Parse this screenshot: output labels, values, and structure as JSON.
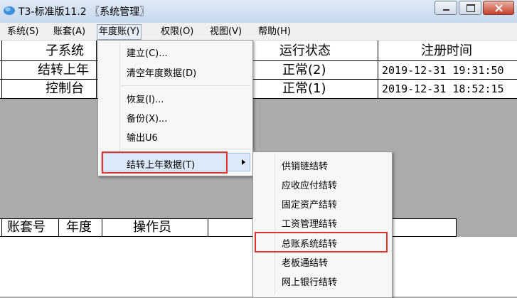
{
  "window": {
    "title": "T3-标准版11.2 〖系统管理〗"
  },
  "menubar": [
    {
      "label": "系统(S)"
    },
    {
      "label": "账套(A)"
    },
    {
      "label": "年度账(Y)"
    },
    {
      "label": "权限(O)"
    },
    {
      "label": "视图(V)"
    },
    {
      "label": "帮助(H)"
    }
  ],
  "upper_table": {
    "columns": [
      "子系统",
      "运行状态",
      "注册时间"
    ],
    "rows": [
      {
        "subsystem": "结转上年",
        "status": "正常(2)",
        "time": "2019-12-31 19:31:50"
      },
      {
        "subsystem": "控制台",
        "status": "正常(1)",
        "time": "2019-12-31 18:52:15"
      }
    ]
  },
  "lower_table": {
    "columns": [
      "账套号",
      "年度",
      "操作员"
    ]
  },
  "year_menu": {
    "items": [
      "建立(C)...",
      "清空年度数据(D)",
      "恢复(I)...",
      "备份(X)...",
      "输出U6",
      "结转上年数据(T)"
    ]
  },
  "carry_submenu": {
    "items": [
      "供销链结转",
      "应收应付结转",
      "固定资产结转",
      "工资管理结转",
      "总账系统结转",
      "老板通结转",
      "网上银行结转"
    ]
  },
  "colors": {
    "highlight_red": "#e2342d"
  }
}
